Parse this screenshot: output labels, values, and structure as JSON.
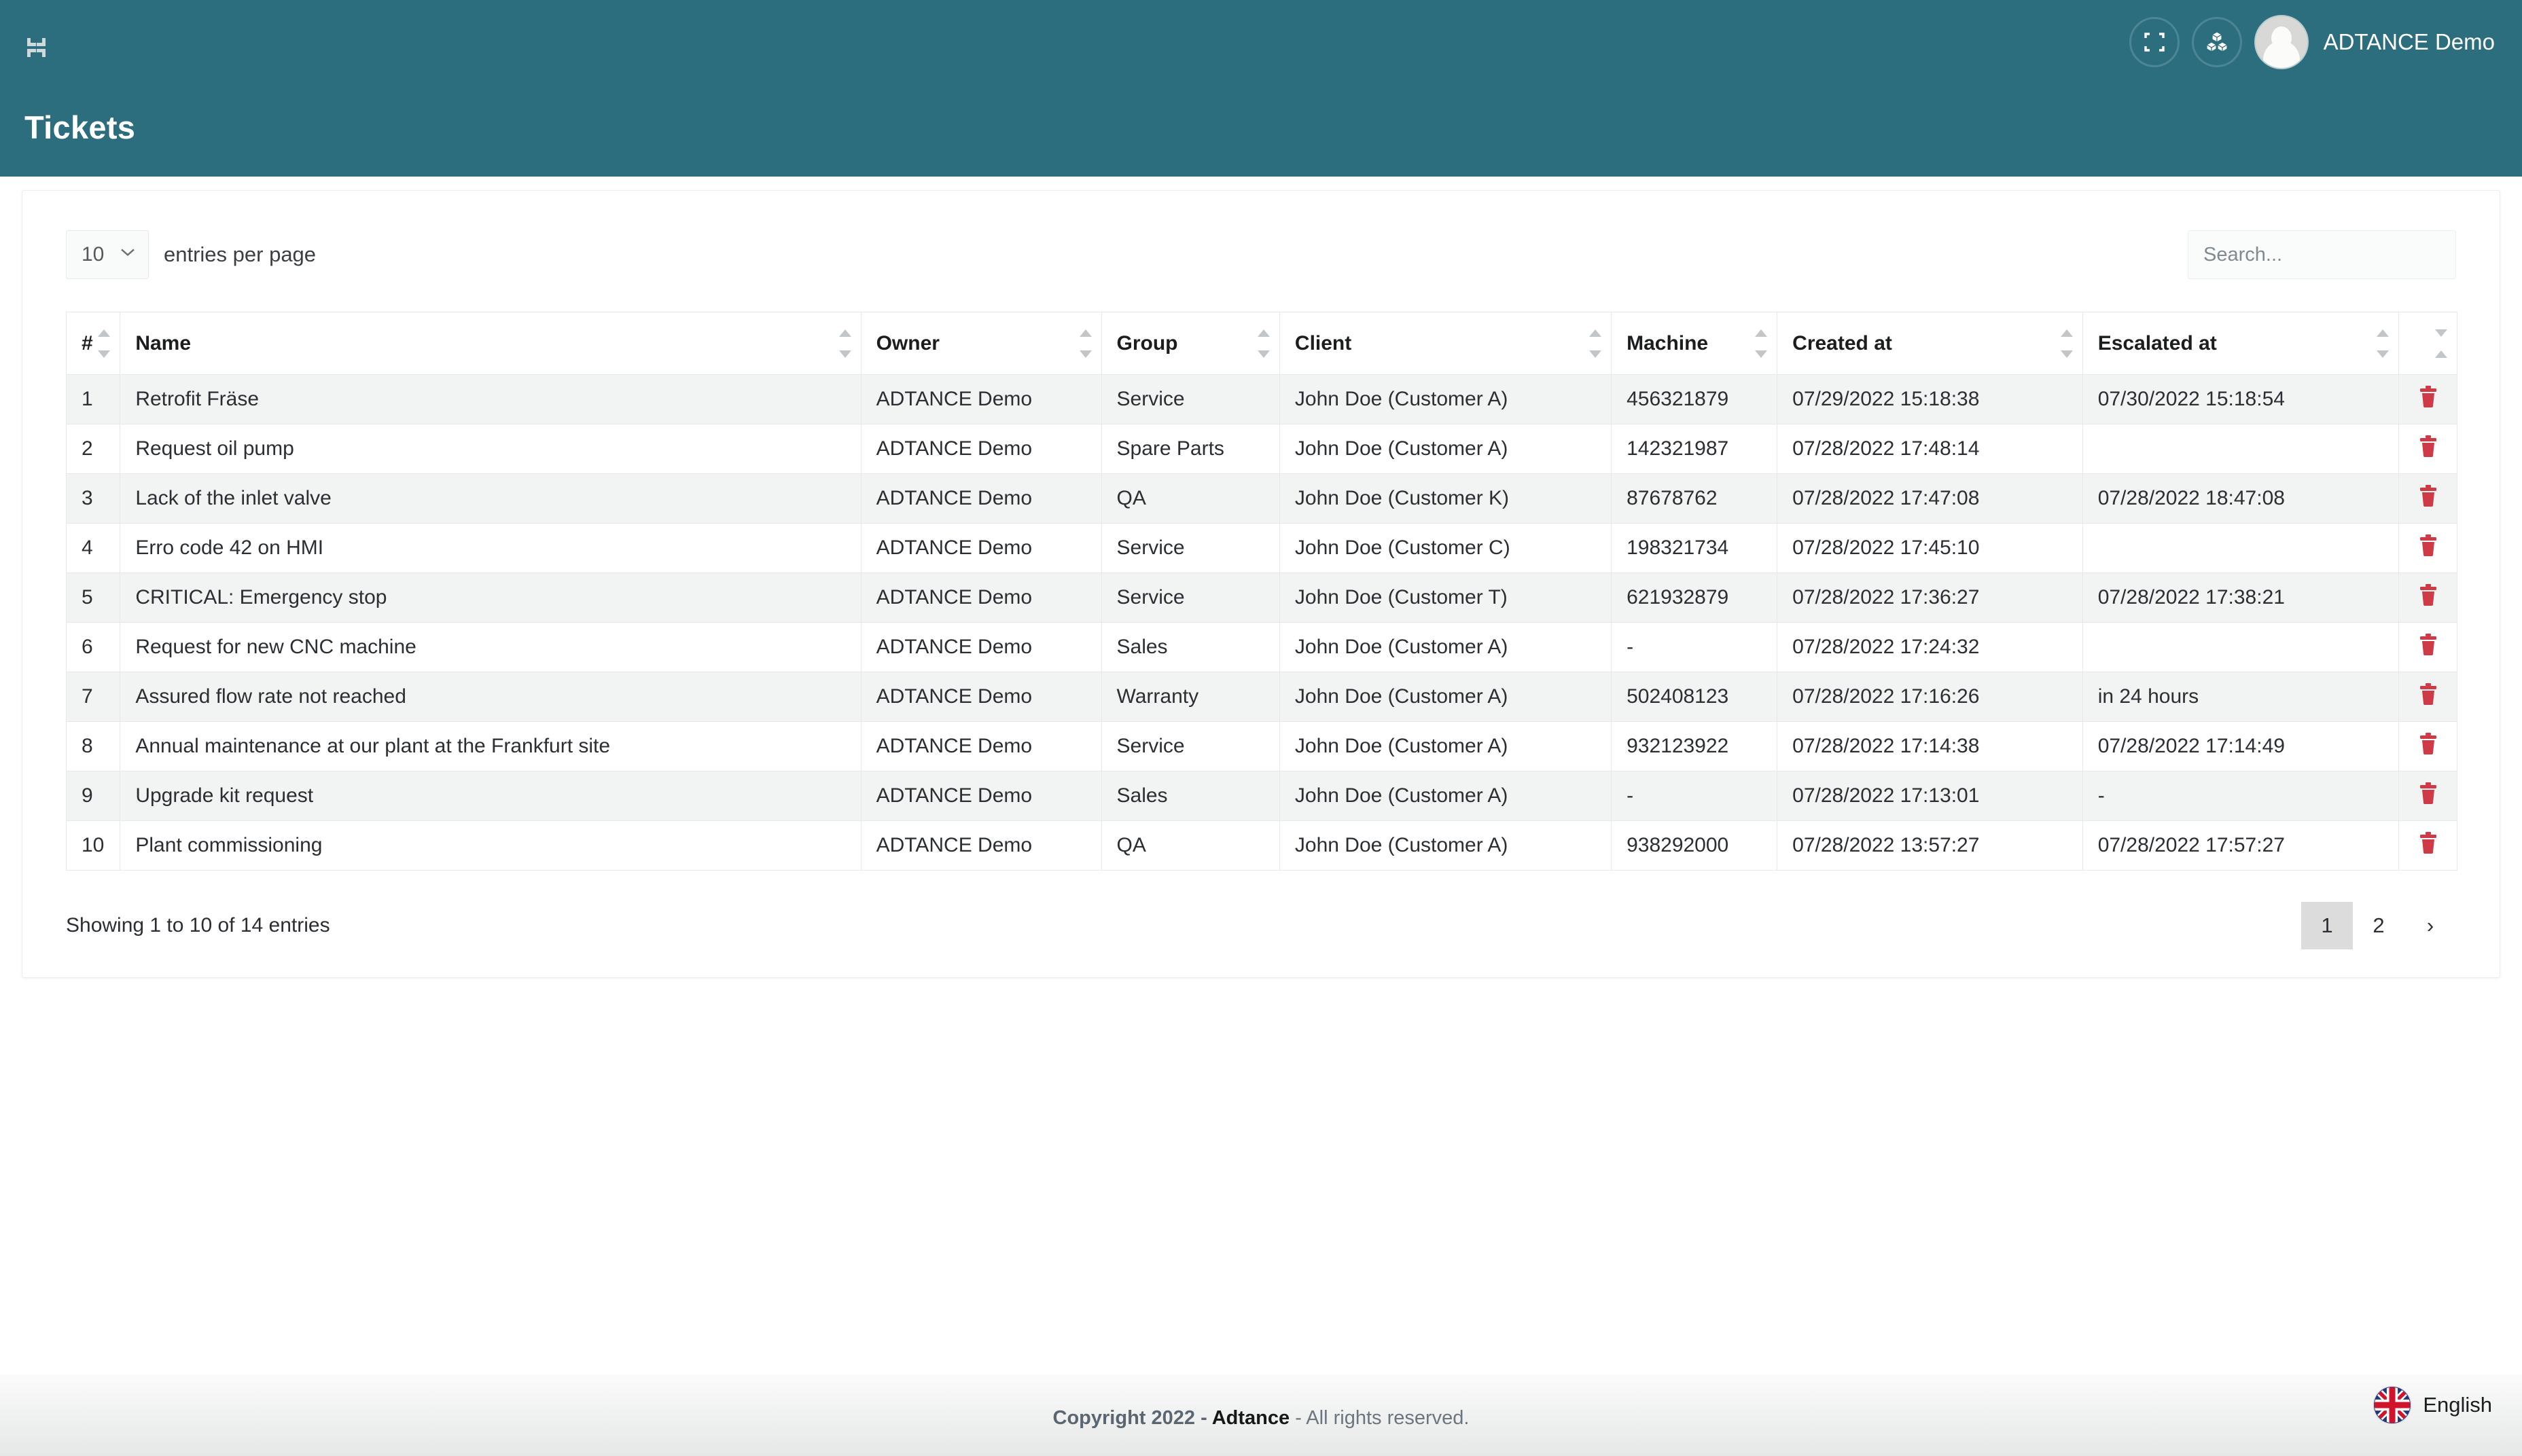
{
  "header": {
    "title": "Tickets",
    "user_name": "ADTANCE Demo",
    "collapse_icon": "collapse-icon",
    "fullscreen_icon": "fullscreen-icon",
    "cubes_icon": "cubes-icon",
    "avatar_icon": "avatar"
  },
  "controls": {
    "per_page_value": "10",
    "per_page_label": "entries per page",
    "search_placeholder": "Search...",
    "search_value": ""
  },
  "table": {
    "columns": [
      {
        "key": "num",
        "label": "#"
      },
      {
        "key": "name",
        "label": "Name"
      },
      {
        "key": "owner",
        "label": "Owner"
      },
      {
        "key": "group",
        "label": "Group"
      },
      {
        "key": "client",
        "label": "Client"
      },
      {
        "key": "machine",
        "label": "Machine"
      },
      {
        "key": "created",
        "label": "Created at"
      },
      {
        "key": "escalated",
        "label": "Escalated at"
      },
      {
        "key": "action",
        "label": ""
      }
    ],
    "rows": [
      {
        "num": "1",
        "name": "Retrofit Fräse",
        "owner": "ADTANCE Demo",
        "group": "Service",
        "client": "John Doe (Customer A)",
        "machine": "456321879",
        "created": "07/29/2022 15:18:38",
        "escalated": "07/30/2022 15:18:54"
      },
      {
        "num": "2",
        "name": "Request oil pump",
        "owner": "ADTANCE Demo",
        "group": "Spare Parts",
        "client": "John Doe (Customer A)",
        "machine": "142321987",
        "created": "07/28/2022 17:48:14",
        "escalated": ""
      },
      {
        "num": "3",
        "name": "Lack of the inlet valve",
        "owner": "ADTANCE Demo",
        "group": "QA",
        "client": "John Doe (Customer K)",
        "machine": "87678762",
        "created": "07/28/2022 17:47:08",
        "escalated": "07/28/2022 18:47:08"
      },
      {
        "num": "4",
        "name": "Erro code 42 on HMI",
        "owner": "ADTANCE Demo",
        "group": "Service",
        "client": "John Doe (Customer C)",
        "machine": "198321734",
        "created": "07/28/2022 17:45:10",
        "escalated": ""
      },
      {
        "num": "5",
        "name": "CRITICAL: Emergency stop",
        "owner": "ADTANCE Demo",
        "group": "Service",
        "client": "John Doe (Customer T)",
        "machine": "621932879",
        "created": "07/28/2022 17:36:27",
        "escalated": "07/28/2022 17:38:21"
      },
      {
        "num": "6",
        "name": "Request for new CNC machine",
        "owner": "ADTANCE Demo",
        "group": "Sales",
        "client": "John Doe (Customer A)",
        "machine": "-",
        "created": "07/28/2022 17:24:32",
        "escalated": ""
      },
      {
        "num": "7",
        "name": "Assured flow rate not reached",
        "owner": "ADTANCE Demo",
        "group": "Warranty",
        "client": "John Doe (Customer A)",
        "machine": "502408123",
        "created": "07/28/2022 17:16:26",
        "escalated": "in 24 hours"
      },
      {
        "num": "8",
        "name": "Annual maintenance at our plant at the Frankfurt site",
        "owner": "ADTANCE Demo",
        "group": "Service",
        "client": "John Doe (Customer A)",
        "machine": "932123922",
        "created": "07/28/2022 17:14:38",
        "escalated": "07/28/2022 17:14:49"
      },
      {
        "num": "9",
        "name": "Upgrade kit request",
        "owner": "ADTANCE Demo",
        "group": "Sales",
        "client": "John Doe (Customer A)",
        "machine": "-",
        "created": "07/28/2022 17:13:01",
        "escalated": "-"
      },
      {
        "num": "10",
        "name": "Plant commissioning",
        "owner": "ADTANCE Demo",
        "group": "QA",
        "client": "John Doe (Customer A)",
        "machine": "938292000",
        "created": "07/28/2022 13:57:27",
        "escalated": "07/28/2022 17:57:27"
      }
    ],
    "delete_icon": "trash-icon"
  },
  "footer_bar": {
    "showing_text": "Showing 1 to 10 of 14 entries",
    "pages": [
      {
        "label": "1",
        "active": true
      },
      {
        "label": "2",
        "active": false
      }
    ],
    "next_label": "›"
  },
  "page_footer": {
    "copyright_prefix": "Copyright 2022 - ",
    "brand": "Adtance",
    "copyright_suffix": " - All rights reserved.",
    "language": "English",
    "flag_icon": "uk-flag-icon"
  },
  "colors": {
    "header_teal": "#2d6e7e",
    "delete_red": "#cf3a47",
    "row_stripe": "#f2f3f3",
    "active_page": "#dcdcdc"
  }
}
